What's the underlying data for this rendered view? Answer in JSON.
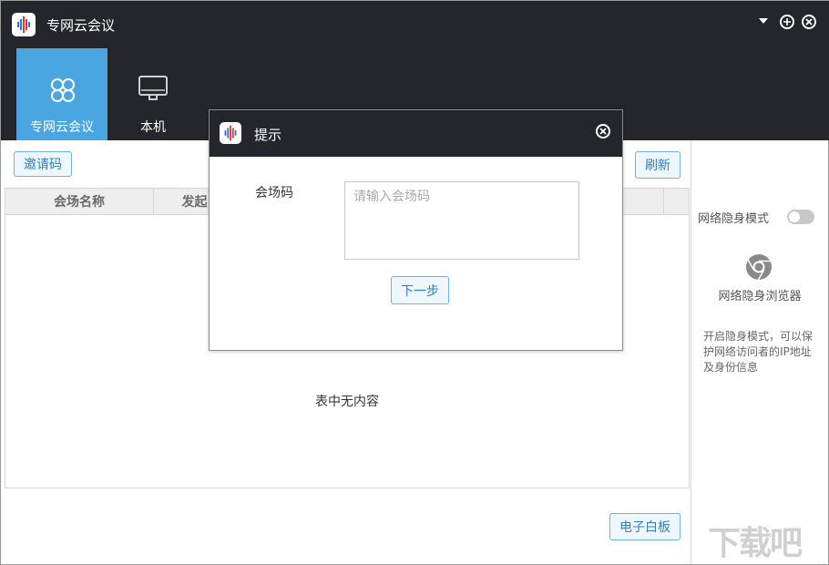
{
  "app": {
    "title": "专网云会议"
  },
  "nav": [
    {
      "label": "专网云会议",
      "icon": "meeting-icon",
      "active": true
    },
    {
      "label": "本机",
      "icon": "monitor-icon",
      "active": false
    }
  ],
  "toolbar": {
    "invite_label": "邀请码",
    "refresh_label": "刷新"
  },
  "table": {
    "columns": [
      "会场名称",
      "发起"
    ],
    "empty_text": "表中无内容"
  },
  "bottom": {
    "whiteboard_label": "电子白板"
  },
  "right_panel": {
    "stealth_mode_label": "网络隐身模式",
    "stealth_mode_on": false,
    "browser_label": "网络隐身浏览器",
    "description": "开启隐身模式，可以保护网络访问者的IP地址及身份信息"
  },
  "dialog": {
    "title": "提示",
    "field_label": "会场码",
    "placeholder": "请输入会场码",
    "next_label": "下一步"
  },
  "watermark": "下载吧",
  "colors": {
    "titlebar": "#24262b",
    "accent": "#4aa6e0",
    "button_text": "#2a82c8"
  }
}
